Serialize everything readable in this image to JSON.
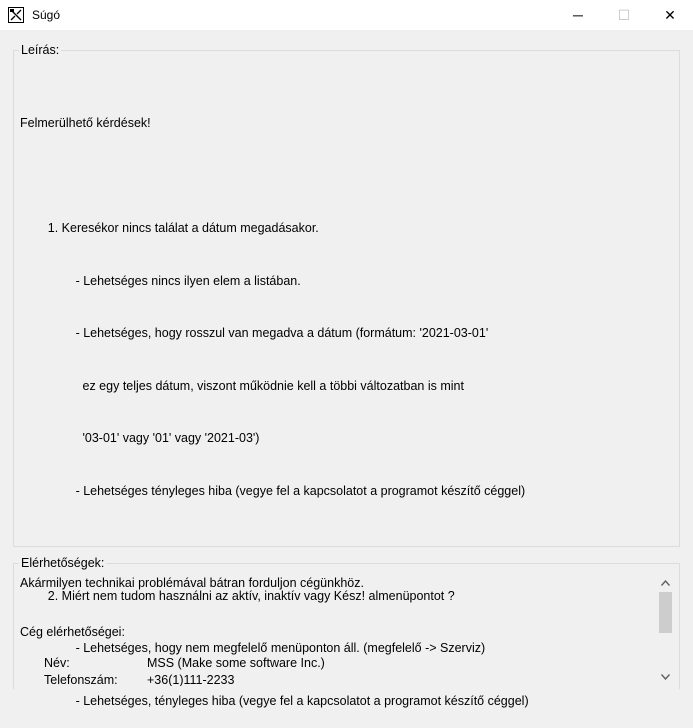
{
  "window": {
    "title": "Súgó",
    "minimize_glyph": "─",
    "maximize_glyph": "☐",
    "close_glyph": "✕"
  },
  "description": {
    "legend": "Leírás:",
    "lines": [
      "Felmerülhető kérdések!",
      "",
      "        1. Keresékor nincs találat a dátum megadásakor.",
      "                - Lehetséges nincs ilyen elem a listában.",
      "                - Lehetséges, hogy rosszul van megadva a dátum (formátum: '2021-03-01'",
      "                  ez egy teljes dátum, viszont működnie kell a többi változatban is mint",
      "                  '03-01' vagy '01' vagy '2021-03')",
      "                - Lehetséges tényleges hiba (vegye fel a kapcsolatot a programot készítő céggel)",
      "",
      "        2. Miért nem tudom használni az aktív, inaktív vagy Kész! almenüpontot ?",
      "                - Lehetséges, hogy nem megfelelő menüponton áll. (megfelelő -> Szerviz)",
      "                - Lehetséges, tényleges hiba (vegye fel a kapcsolatot a programot készítő céggel)"
    ]
  },
  "contacts": {
    "legend": "Elérhetőségek:",
    "intro": "Akármilyen technikai problémával bátran forduljon cégünkhöz.",
    "section_title": "Cég elérhetőségei:",
    "rows": [
      {
        "label": "Név:",
        "value": "MSS (Make some software Inc.)"
      },
      {
        "label": "Telefonszám:",
        "value": "+36(1)111-2233"
      }
    ]
  },
  "icons": {
    "app": "help-app-icon",
    "scroll_up": "▲",
    "scroll_down": "▼"
  }
}
